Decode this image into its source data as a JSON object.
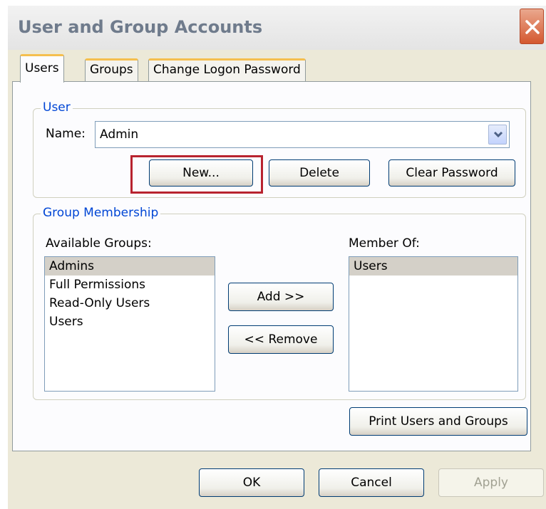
{
  "dialog": {
    "title": "User and Group Accounts"
  },
  "tabs": [
    {
      "label": "Users",
      "active": true
    },
    {
      "label": "Groups",
      "active": false
    },
    {
      "label": "Change Logon Password",
      "active": false
    }
  ],
  "user": {
    "legend": "User",
    "name_label": "Name:",
    "name_value": "Admin",
    "new_label": "New...",
    "delete_label": "Delete",
    "clear_password_label": "Clear Password"
  },
  "membership": {
    "legend": "Group Membership",
    "available_label": "Available Groups:",
    "available": [
      "Admins",
      "Full Permissions",
      "Read-Only Users",
      "Users"
    ],
    "member_of_label": "Member Of:",
    "member_of": [
      "Users"
    ],
    "add_label": "Add >>",
    "remove_label": "<< Remove"
  },
  "print_label": "Print Users and Groups",
  "footer": {
    "ok_label": "OK",
    "cancel_label": "Cancel",
    "apply_label": "Apply"
  },
  "colors": {
    "legend_text": "#0046d5",
    "tab_accent": "#f5bf4e",
    "highlight_border": "#b8232f",
    "close_button": "#d4582f"
  }
}
